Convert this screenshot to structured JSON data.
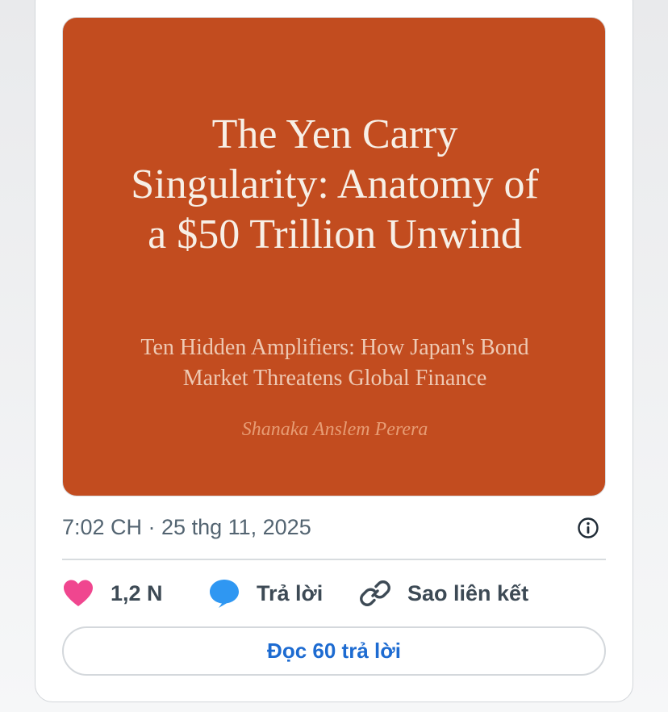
{
  "media": {
    "title": "The Yen Carry Singularity: Anatomy of a $50 Trillion Unwind",
    "subtitle": "Ten Hidden Amplifiers: How Japan's Bond Market Threatens Global Finance",
    "author": "Shanaka Anslem Perera",
    "background_color": "#c24c1f"
  },
  "post": {
    "timestamp": "7:02 CH · 25 thg 11, 2025"
  },
  "actions": {
    "like_count": "1,2 N",
    "reply_label": "Trả lời",
    "copy_link_label": "Sao liên kết"
  },
  "footer": {
    "read_replies_label": "Đọc 60 trả lời"
  },
  "icons": {
    "like": "heart-icon",
    "reply": "speech-bubble-icon",
    "copy_link": "link-icon",
    "info": "info-icon"
  },
  "colors": {
    "like": "#f0468f",
    "reply": "#2f97f2",
    "accent_link": "#1d6bd1",
    "muted_text": "#536471"
  }
}
